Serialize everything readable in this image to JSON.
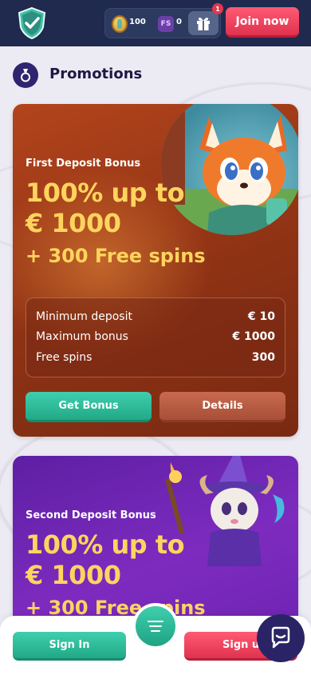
{
  "header": {
    "coins": "100",
    "free_spins_badge": "FS",
    "free_spins_count": "0",
    "gift_count": "1",
    "join_label": "Join now"
  },
  "section": {
    "title": "Promotions"
  },
  "promos": [
    {
      "subtitle": "First Deposit Bonus",
      "headline_line1": "100% up to",
      "headline_line2": "€ 1000",
      "spins": "+ 300 Free spins",
      "details": [
        {
          "label": "Minimum deposit",
          "value": "€ 10"
        },
        {
          "label": "Maximum bonus",
          "value": "€ 1000"
        },
        {
          "label": "Free spins",
          "value": "300"
        }
      ],
      "get_bonus_label": "Get Bonus",
      "details_label": "Details"
    },
    {
      "subtitle": "Second Deposit Bonus",
      "headline_line1": "100% up to",
      "headline_line2": "€ 1000",
      "spins": "+ 300 Free spins"
    }
  ],
  "bottom": {
    "signin_label": "Sign In",
    "signup_label": "Sign up"
  },
  "colors": {
    "header_bg": "#1f2a4e",
    "accent_green": "#2bbf9c",
    "accent_red": "#f0435f",
    "gold": "#ffd45e",
    "card1_bg": "#a13c18",
    "card2_bg": "#6e25b2"
  }
}
